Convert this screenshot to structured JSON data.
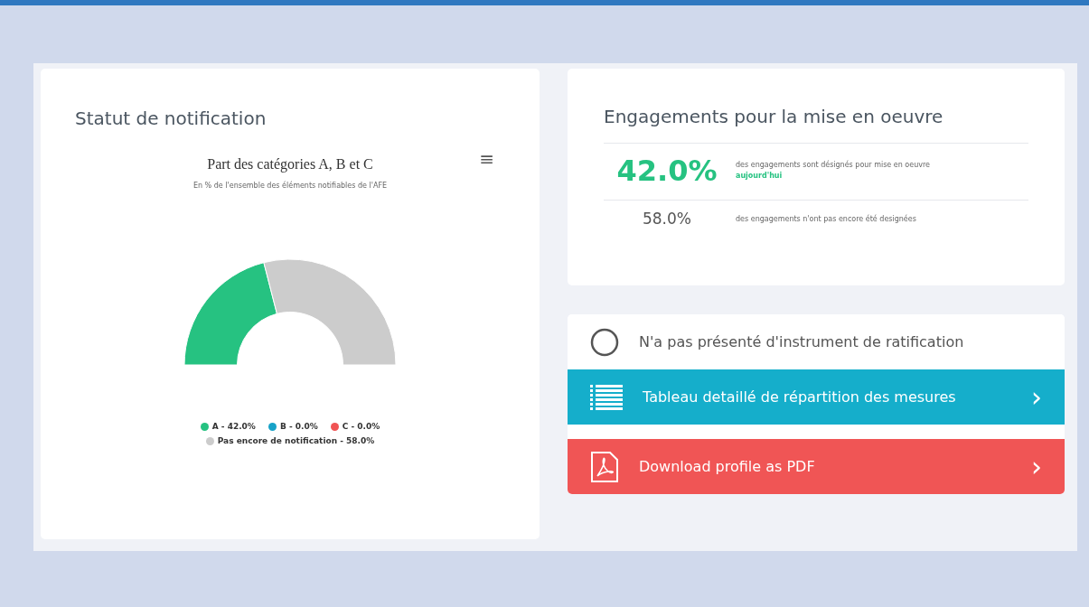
{
  "notification_panel": {
    "title": "Statut de notification",
    "menu_icon": "≡",
    "subtitle": "En % de l'ensemble des éléments notifiables de l'AFE",
    "chart_data": {
      "type": "donut",
      "title": "Part des catégories A, B et C",
      "values": [
        42.0,
        0.0,
        0.0,
        58.0
      ]
    },
    "legend": [
      {
        "label": "A - 42.0%",
        "color": "#26c281"
      },
      {
        "label": "B - 0.0%",
        "color": "#17a2c8"
      },
      {
        "label": "C - 0.0%",
        "color": "#f05454"
      },
      {
        "label": "Pas encore de notification - 58.0%",
        "color": "#cccccc"
      }
    ]
  },
  "engagements_panel": {
    "title": "Engagements pour la mise en oeuvre",
    "stats": [
      {
        "kind": "highlight",
        "value": "42.0%",
        "text": "des engagements sont désignés pour mise en oeuvre",
        "note": "aujourd'hui"
      },
      {
        "kind": "plain",
        "value": "58.0%",
        "text": "des engagements n'ont pas encore été designées"
      }
    ]
  },
  "actions": [
    {
      "kind": "status",
      "label": "N'a pas présenté d'instrument de ratification"
    },
    {
      "kind": "table",
      "label": "Tableau detaillé de répartition des mesures",
      "arrow": "›"
    },
    {
      "kind": "pdf",
      "label": "Download profile as PDF",
      "arrow": "›"
    }
  ]
}
